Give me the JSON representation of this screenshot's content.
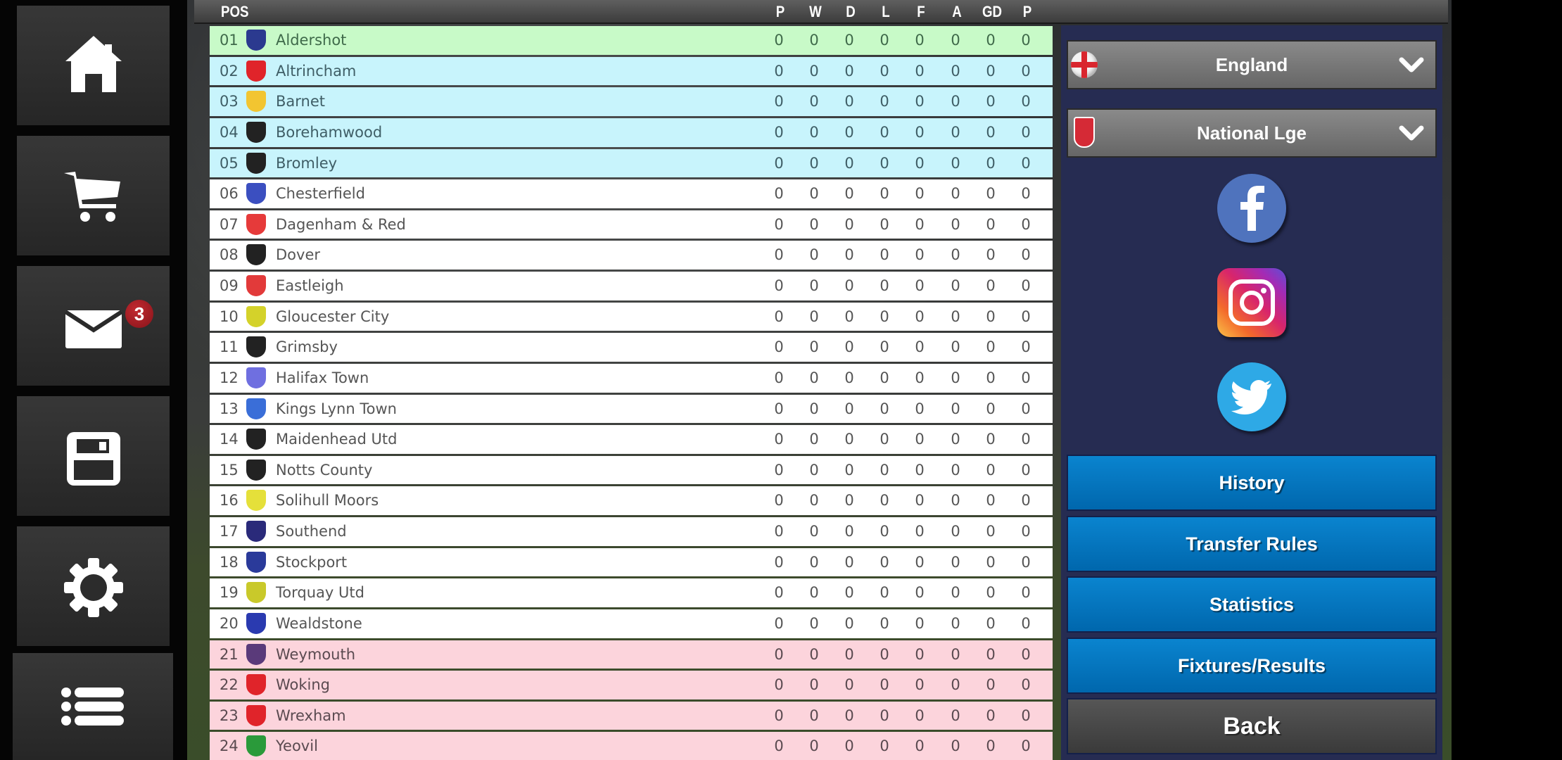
{
  "sidebar": {
    "items": [
      {
        "name": "home",
        "icon": "home-icon"
      },
      {
        "name": "shop",
        "icon": "cart-icon"
      },
      {
        "name": "messages",
        "icon": "mail-icon",
        "badge": "3"
      },
      {
        "name": "save",
        "icon": "save-icon"
      },
      {
        "name": "settings",
        "icon": "gear-icon"
      },
      {
        "name": "menu",
        "icon": "list-icon"
      }
    ]
  },
  "table": {
    "columns": [
      "POS",
      "P",
      "W",
      "D",
      "L",
      "F",
      "A",
      "GD",
      "P"
    ],
    "rows": [
      {
        "pos": "01",
        "team": "Aldershot",
        "zone": "promo",
        "crest": "#2b3a8f",
        "stats": [
          "0",
          "0",
          "0",
          "0",
          "0",
          "0",
          "0",
          "0"
        ]
      },
      {
        "pos": "02",
        "team": "Altrincham",
        "zone": "playoff",
        "crest": "#e0242a",
        "stats": [
          "0",
          "0",
          "0",
          "0",
          "0",
          "0",
          "0",
          "0"
        ]
      },
      {
        "pos": "03",
        "team": "Barnet",
        "zone": "playoff",
        "crest": "#f2c531",
        "stats": [
          "0",
          "0",
          "0",
          "0",
          "0",
          "0",
          "0",
          "0"
        ]
      },
      {
        "pos": "04",
        "team": "Borehamwood",
        "zone": "playoff",
        "crest": "#222222",
        "stats": [
          "0",
          "0",
          "0",
          "0",
          "0",
          "0",
          "0",
          "0"
        ]
      },
      {
        "pos": "05",
        "team": "Bromley",
        "zone": "playoff",
        "crest": "#222222",
        "stats": [
          "0",
          "0",
          "0",
          "0",
          "0",
          "0",
          "0",
          "0"
        ]
      },
      {
        "pos": "06",
        "team": "Chesterfield",
        "zone": "none",
        "crest": "#3b4fc0",
        "stats": [
          "0",
          "0",
          "0",
          "0",
          "0",
          "0",
          "0",
          "0"
        ]
      },
      {
        "pos": "07",
        "team": "Dagenham & Red",
        "zone": "none",
        "crest": "#e63a3a",
        "stats": [
          "0",
          "0",
          "0",
          "0",
          "0",
          "0",
          "0",
          "0"
        ]
      },
      {
        "pos": "08",
        "team": "Dover",
        "zone": "none",
        "crest": "#222222",
        "stats": [
          "0",
          "0",
          "0",
          "0",
          "0",
          "0",
          "0",
          "0"
        ]
      },
      {
        "pos": "09",
        "team": "Eastleigh",
        "zone": "none",
        "crest": "#e23a3a",
        "stats": [
          "0",
          "0",
          "0",
          "0",
          "0",
          "0",
          "0",
          "0"
        ]
      },
      {
        "pos": "10",
        "team": "Gloucester City",
        "zone": "none",
        "crest": "#d4d22a",
        "stats": [
          "0",
          "0",
          "0",
          "0",
          "0",
          "0",
          "0",
          "0"
        ]
      },
      {
        "pos": "11",
        "team": "Grimsby",
        "zone": "none",
        "crest": "#222222",
        "stats": [
          "0",
          "0",
          "0",
          "0",
          "0",
          "0",
          "0",
          "0"
        ]
      },
      {
        "pos": "12",
        "team": "Halifax Town",
        "zone": "none",
        "crest": "#6f6fe0",
        "stats": [
          "0",
          "0",
          "0",
          "0",
          "0",
          "0",
          "0",
          "0"
        ]
      },
      {
        "pos": "13",
        "team": "Kings Lynn Town",
        "zone": "none",
        "crest": "#3a6ed8",
        "stats": [
          "0",
          "0",
          "0",
          "0",
          "0",
          "0",
          "0",
          "0"
        ]
      },
      {
        "pos": "14",
        "team": "Maidenhead Utd",
        "zone": "none",
        "crest": "#222222",
        "stats": [
          "0",
          "0",
          "0",
          "0",
          "0",
          "0",
          "0",
          "0"
        ]
      },
      {
        "pos": "15",
        "team": "Notts County",
        "zone": "none",
        "crest": "#222222",
        "stats": [
          "0",
          "0",
          "0",
          "0",
          "0",
          "0",
          "0",
          "0"
        ]
      },
      {
        "pos": "16",
        "team": "Solihull Moors",
        "zone": "none",
        "crest": "#e5e03a",
        "stats": [
          "0",
          "0",
          "0",
          "0",
          "0",
          "0",
          "0",
          "0"
        ]
      },
      {
        "pos": "17",
        "team": "Southend",
        "zone": "none",
        "crest": "#2a2a7a",
        "stats": [
          "0",
          "0",
          "0",
          "0",
          "0",
          "0",
          "0",
          "0"
        ]
      },
      {
        "pos": "18",
        "team": "Stockport",
        "zone": "none",
        "crest": "#2a3a9a",
        "stats": [
          "0",
          "0",
          "0",
          "0",
          "0",
          "0",
          "0",
          "0"
        ]
      },
      {
        "pos": "19",
        "team": "Torquay Utd",
        "zone": "none",
        "crest": "#c9c92a",
        "stats": [
          "0",
          "0",
          "0",
          "0",
          "0",
          "0",
          "0",
          "0"
        ]
      },
      {
        "pos": "20",
        "team": "Wealdstone",
        "zone": "none",
        "crest": "#2a3ab0",
        "stats": [
          "0",
          "0",
          "0",
          "0",
          "0",
          "0",
          "0",
          "0"
        ]
      },
      {
        "pos": "21",
        "team": "Weymouth",
        "zone": "releg",
        "crest": "#5a3a7a",
        "stats": [
          "0",
          "0",
          "0",
          "0",
          "0",
          "0",
          "0",
          "0"
        ]
      },
      {
        "pos": "22",
        "team": "Woking",
        "zone": "releg",
        "crest": "#e0242a",
        "stats": [
          "0",
          "0",
          "0",
          "0",
          "0",
          "0",
          "0",
          "0"
        ]
      },
      {
        "pos": "23",
        "team": "Wrexham",
        "zone": "releg",
        "crest": "#e0242a",
        "stats": [
          "0",
          "0",
          "0",
          "0",
          "0",
          "0",
          "0",
          "0"
        ]
      },
      {
        "pos": "24",
        "team": "Yeovil",
        "zone": "releg",
        "crest": "#2a9a3a",
        "stats": [
          "0",
          "0",
          "0",
          "0",
          "0",
          "0",
          "0",
          "0"
        ]
      }
    ]
  },
  "right_panel": {
    "country_select": {
      "value": "England",
      "icon": "england-flag-icon"
    },
    "league_select": {
      "value": "National Lge",
      "icon": "league-badge-icon"
    },
    "social": [
      "facebook",
      "instagram",
      "twitter"
    ],
    "buttons": {
      "history": "History",
      "transfer_rules": "Transfer Rules",
      "statistics": "Statistics",
      "fixtures": "Fixtures/Results",
      "back": "Back"
    }
  },
  "colors": {
    "promotion_row": "#c8fac8",
    "playoff_row": "#c8f4fc",
    "relegation_row": "#fcd4dc",
    "menu_button": "#0a7cc4",
    "panel_bg": "#262c52",
    "badge": "#a8191f"
  }
}
